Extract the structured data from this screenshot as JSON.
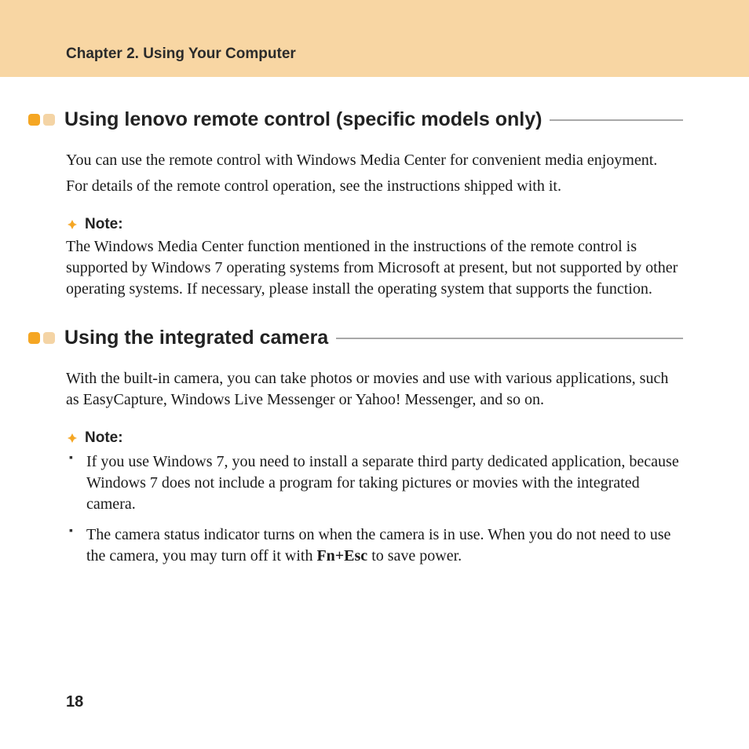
{
  "header": {
    "chapter": "Chapter 2. Using Your Computer"
  },
  "section1": {
    "title": "Using lenovo remote control (specific models only)",
    "para1": "You can use the remote control with Windows Media Center for convenient media enjoyment.",
    "para2": "For details of the remote control operation, see the instructions shipped with it.",
    "note_label": "Note:",
    "note_body": "The Windows Media Center function mentioned in the instructions of the remote control is supported by Windows 7 operating systems from Microsoft at present, but not supported by other operating systems. If necessary, please install the operating system that supports the function."
  },
  "section2": {
    "title": "Using the integrated camera",
    "para1": "With the built-in camera, you can take photos or movies and use with various applications, such as EasyCapture, Windows Live Messenger or Yahoo! Messenger, and so on.",
    "note_label": "Note:",
    "bullets": {
      "0": "If you use Windows 7, you need to install a separate third party dedicated application, because Windows 7 does not include a program for taking pictures or movies with the integrated camera.",
      "1_pre": "The camera status indicator turns on when the camera is in use. When you do not need to use the camera, you may turn off it with ",
      "1_bold": "Fn+Esc",
      "1_post": " to save power."
    }
  },
  "page_number": "18"
}
